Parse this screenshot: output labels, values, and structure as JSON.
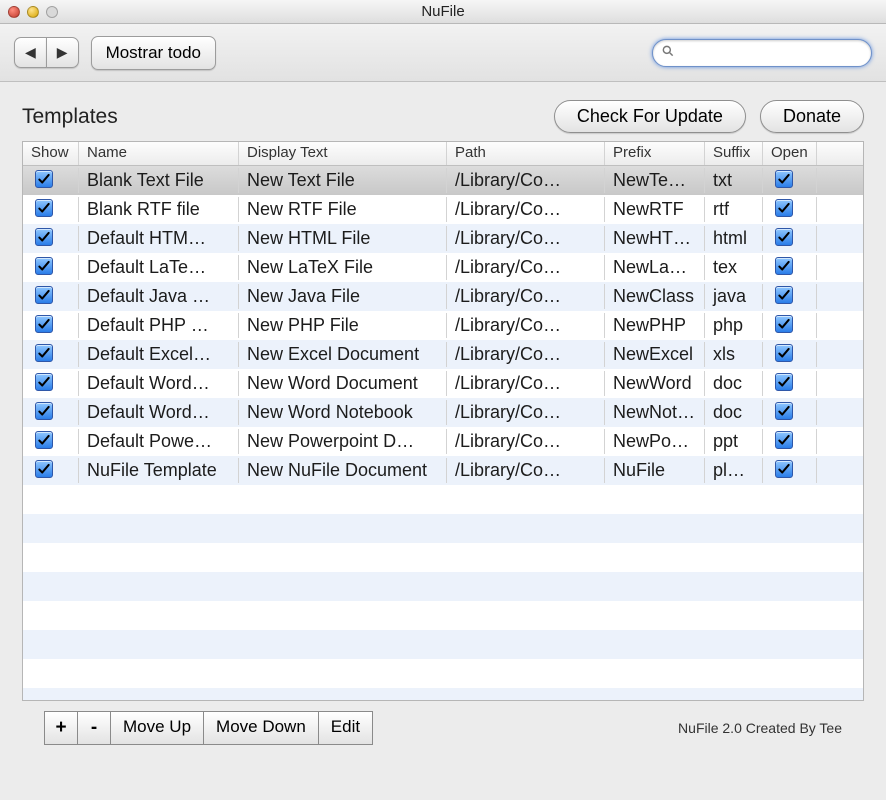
{
  "window": {
    "title": "NuFile"
  },
  "toolbar": {
    "show_all_label": "Mostrar todo",
    "search_placeholder": ""
  },
  "section": {
    "title": "Templates",
    "check_update_label": "Check For Update",
    "donate_label": "Donate"
  },
  "columns": {
    "show": "Show",
    "name": "Name",
    "display": "Display Text",
    "path": "Path",
    "prefix": "Prefix",
    "suffix": "Suffix",
    "open": "Open"
  },
  "rows": [
    {
      "show": true,
      "name": "Blank Text File",
      "display": "New Text File",
      "path": "/Library/Co…",
      "prefix": "NewTe…",
      "suffix": "txt",
      "open": true,
      "selected": true
    },
    {
      "show": true,
      "name": "Blank RTF file",
      "display": "New RTF File",
      "path": "/Library/Co…",
      "prefix": "NewRTF",
      "suffix": "rtf",
      "open": true
    },
    {
      "show": true,
      "name": "Default HTM…",
      "display": "New HTML File",
      "path": "/Library/Co…",
      "prefix": "NewHTML",
      "suffix": "html",
      "open": true
    },
    {
      "show": true,
      "name": "Default LaTe…",
      "display": "New LaTeX File",
      "path": "/Library/Co…",
      "prefix": "NewLaTeX",
      "suffix": "tex",
      "open": true
    },
    {
      "show": true,
      "name": "Default Java …",
      "display": "New Java File",
      "path": "/Library/Co…",
      "prefix": "NewClass",
      "suffix": "java",
      "open": true
    },
    {
      "show": true,
      "name": "Default PHP …",
      "display": "New PHP File",
      "path": "/Library/Co…",
      "prefix": "NewPHP",
      "suffix": "php",
      "open": true
    },
    {
      "show": true,
      "name": "Default Excel…",
      "display": "New Excel Document",
      "path": "/Library/Co…",
      "prefix": "NewExcel",
      "suffix": "xls",
      "open": true
    },
    {
      "show": true,
      "name": "Default Word…",
      "display": "New Word Document",
      "path": "/Library/Co…",
      "prefix": "NewWord",
      "suffix": "doc",
      "open": true
    },
    {
      "show": true,
      "name": "Default Word…",
      "display": "New Word Notebook",
      "path": "/Library/Co…",
      "prefix": "NewNot…",
      "suffix": "doc",
      "open": true
    },
    {
      "show": true,
      "name": "Default Powe…",
      "display": "New Powerpoint D…",
      "path": "/Library/Co…",
      "prefix": "NewPo…",
      "suffix": "ppt",
      "open": true
    },
    {
      "show": true,
      "name": "NuFile Template",
      "display": "New NuFile Document",
      "path": "/Library/Co…",
      "prefix": "NuFile",
      "suffix": "pl…",
      "open": true
    }
  ],
  "bottom": {
    "add": "+",
    "remove": "-",
    "move_up": "Move Up",
    "move_down": "Move Down",
    "edit": "Edit",
    "credit": "NuFile 2.0 Created By Tee"
  }
}
